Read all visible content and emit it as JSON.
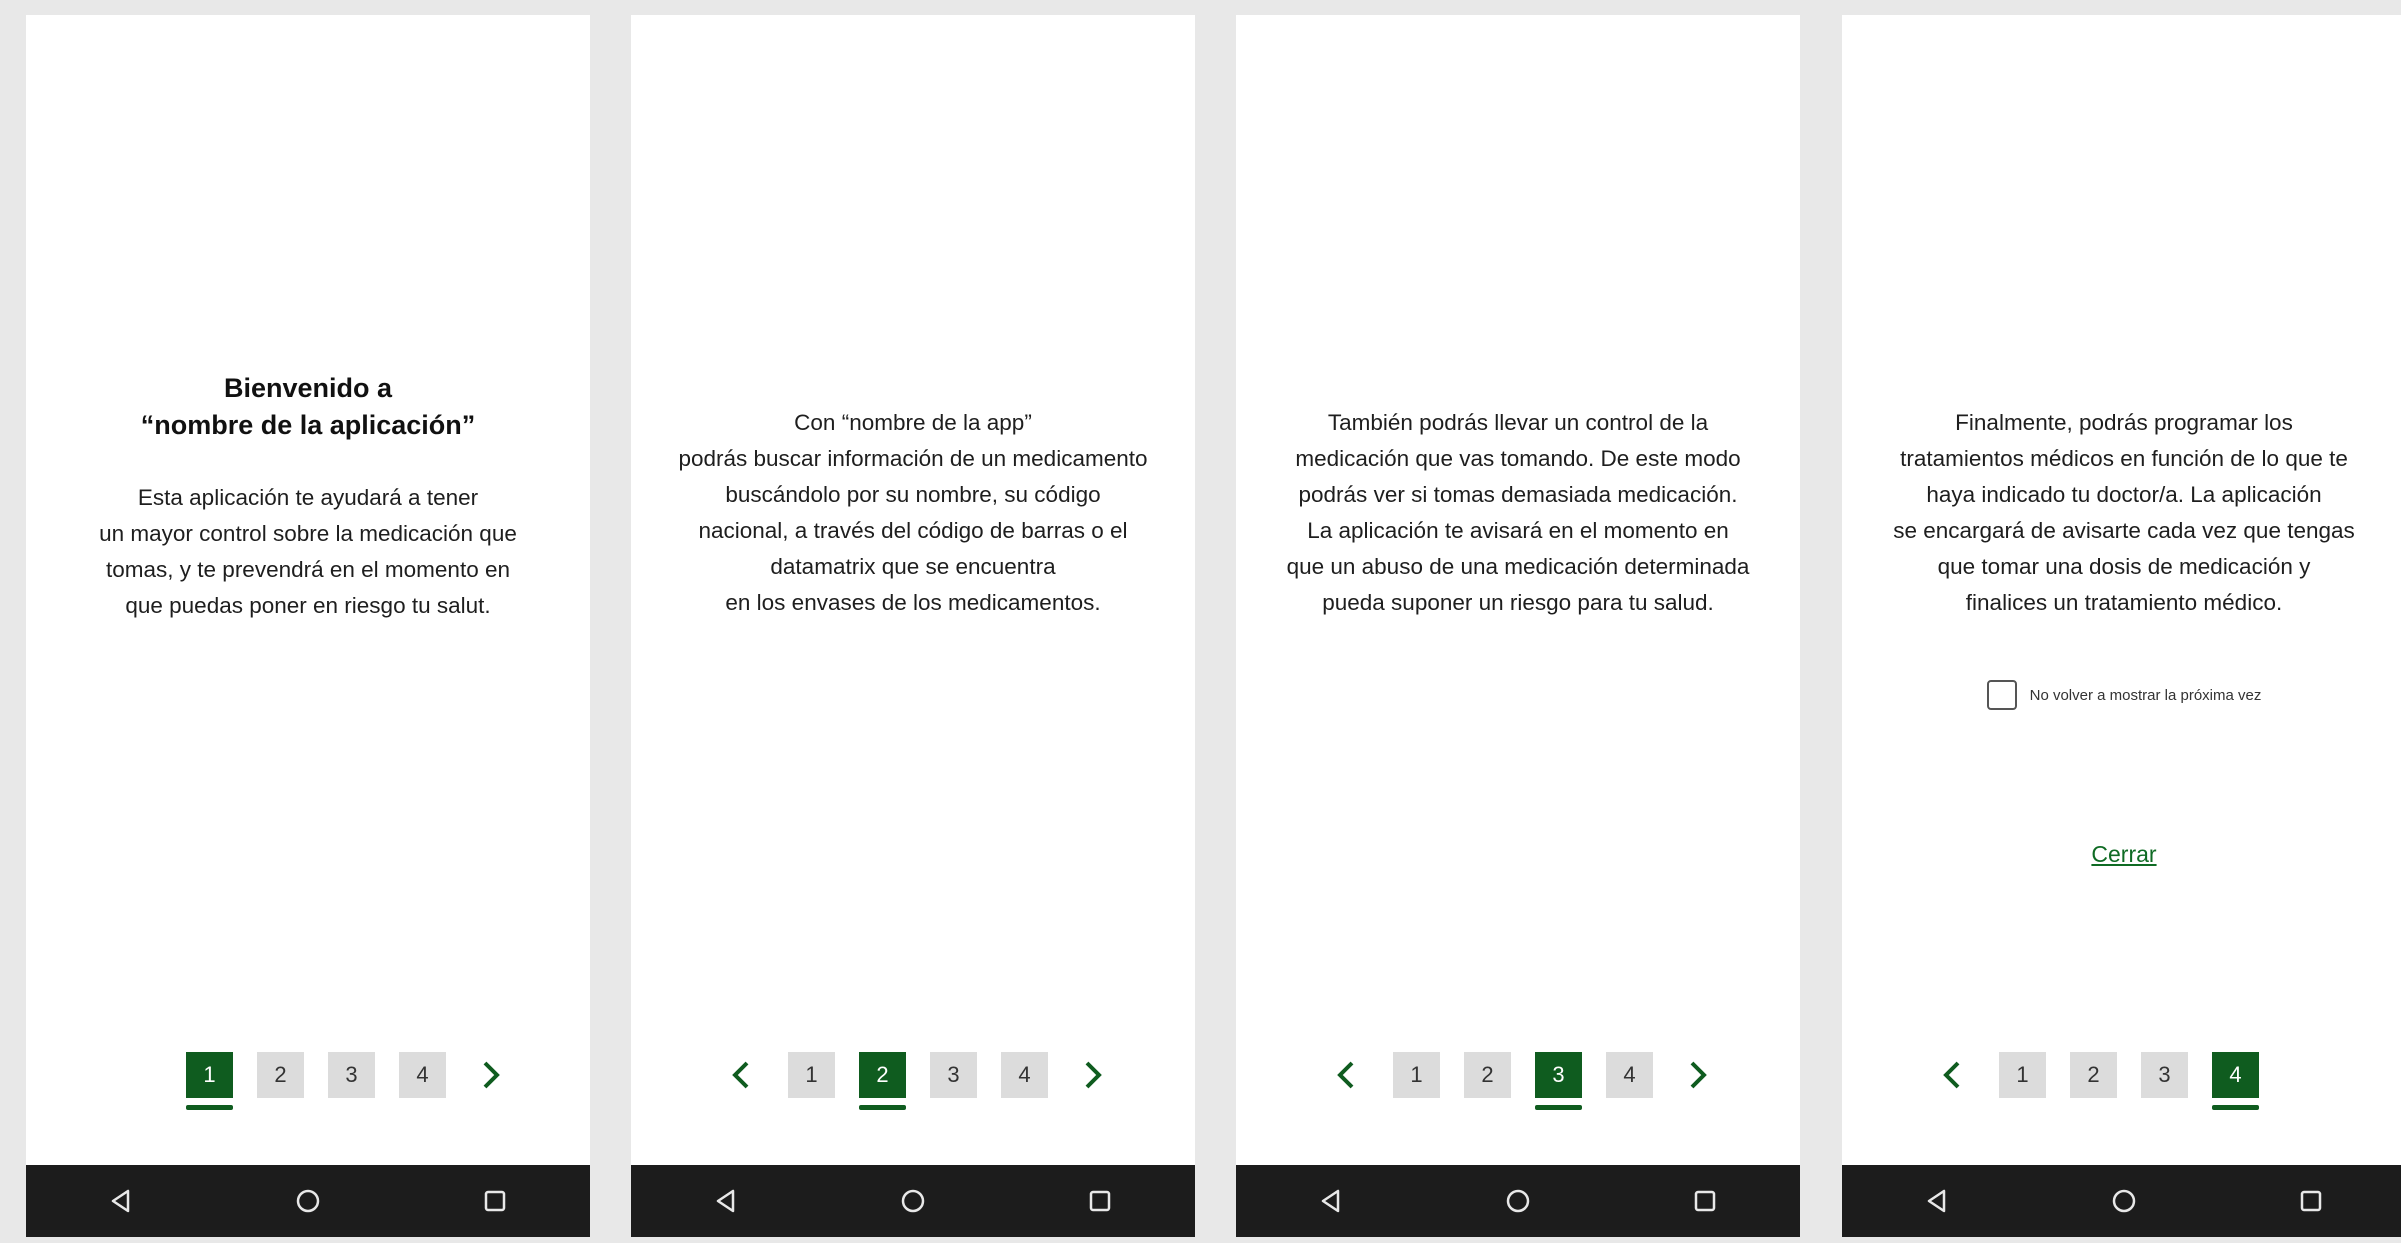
{
  "colors": {
    "accent": "#0f5c1f",
    "link": "#0f6b24",
    "navbar": "#1c1c1c",
    "page_inactive": "#dcdcdc",
    "background": "#e8e8e8"
  },
  "screens": [
    {
      "title_lines": [
        "Bienvenido a",
        "“nombre de la aplicación”"
      ],
      "body_lines": [
        "Esta aplicación te ayudará a tener",
        "un mayor control sobre la medicación que",
        "tomas, y te prevendrá en el momento en",
        "que puedas poner en riesgo tu salut."
      ],
      "pages": [
        "1",
        "2",
        "3",
        "4"
      ],
      "active_page": "1",
      "has_prev": false,
      "has_next": true
    },
    {
      "body_lines": [
        "Con “nombre de la app”",
        "podrás buscar información de un medicamento",
        "buscándolo por su nombre, su código",
        "nacional, a través del código de barras o el",
        "datamatrix que se encuentra",
        "en los envases de los medicamentos."
      ],
      "pages": [
        "1",
        "2",
        "3",
        "4"
      ],
      "active_page": "2",
      "has_prev": true,
      "has_next": true
    },
    {
      "body_lines": [
        "También podrás llevar un control de la",
        "medicación que vas tomando. De este modo",
        "podrás ver si tomas demasiada medicación.",
        "La aplicación te avisará en el momento en",
        "que un abuso de una medicación determinada",
        "pueda suponer un riesgo para tu salud."
      ],
      "pages": [
        "1",
        "2",
        "3",
        "4"
      ],
      "active_page": "3",
      "has_prev": true,
      "has_next": true
    },
    {
      "body_lines": [
        "Finalmente, podrás programar los",
        "tratamientos médicos en función de lo que te",
        "haya indicado tu doctor/a. La aplicación",
        "se encargará de avisarte cada vez que tengas",
        "que tomar una dosis de medicación y",
        "finalices un tratamiento médico."
      ],
      "checkbox_label": "No volver a mostrar la próxima vez",
      "checkbox_checked": false,
      "close_label": "Cerrar",
      "pages": [
        "1",
        "2",
        "3",
        "4"
      ],
      "active_page": "4",
      "has_prev": true,
      "has_next": false
    }
  ],
  "nav_icons": [
    "back-triangle-icon",
    "home-circle-icon",
    "recents-square-icon"
  ]
}
